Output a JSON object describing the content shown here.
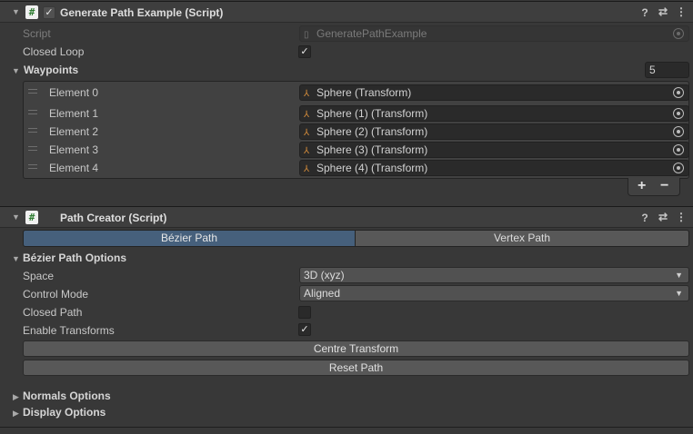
{
  "generate_component": {
    "title": "Generate Path Example (Script)",
    "enabled": true,
    "fields": {
      "script_label": "Script",
      "script_value": "GeneratePathExample",
      "closed_loop_label": "Closed Loop",
      "closed_loop_checked": true,
      "waypoints_label": "Waypoints",
      "waypoints_count": "5"
    },
    "elements": [
      {
        "label": "Element 0",
        "value": "Sphere (Transform)"
      },
      {
        "label": "Element 1",
        "value": "Sphere (1) (Transform)"
      },
      {
        "label": "Element 2",
        "value": "Sphere (2) (Transform)"
      },
      {
        "label": "Element 3",
        "value": "Sphere (3) (Transform)"
      },
      {
        "label": "Element 4",
        "value": "Sphere (4) (Transform)"
      }
    ],
    "add_label": "+",
    "remove_label": "−"
  },
  "path_creator": {
    "title": "Path Creator (Script)",
    "tabs": [
      "Bézier Path",
      "Vertex Path"
    ],
    "active_tab": "Bézier Path",
    "bezier_options_label": "Bézier Path Options",
    "space_label": "Space",
    "space_value": "3D (xyz)",
    "control_mode_label": "Control Mode",
    "control_mode_value": "Aligned",
    "closed_path_label": "Closed Path",
    "closed_path_checked": false,
    "enable_transforms_label": "Enable Transforms",
    "enable_transforms_checked": true,
    "centre_transform_label": "Centre Transform",
    "reset_path_label": "Reset Path",
    "normals_options_label": "Normals Options",
    "display_options_label": "Display Options"
  },
  "header_icons": {
    "help": "?",
    "presets": "⇄",
    "menu": "⋮"
  },
  "icons": {
    "fold_open": "▼",
    "fold_closed": "▶",
    "check": "✓",
    "script_glyph": "#",
    "transform_glyph": "⅄",
    "caret": "▼"
  }
}
